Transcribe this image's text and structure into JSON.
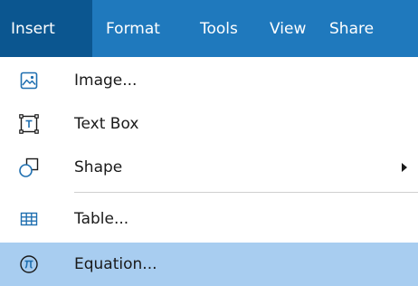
{
  "menubar": {
    "items": [
      {
        "label": "Insert",
        "active": true
      },
      {
        "label": "Format"
      },
      {
        "label": "Tools"
      },
      {
        "label": "View"
      },
      {
        "label": "Share"
      }
    ]
  },
  "menu": {
    "items": [
      {
        "label": "Image...",
        "icon": "image-icon"
      },
      {
        "label": "Text Box",
        "icon": "text-box-icon"
      },
      {
        "label": "Shape",
        "icon": "shape-icon",
        "submenu": true
      },
      {
        "label": "Table...",
        "icon": "table-icon"
      },
      {
        "label": "Equation...",
        "icon": "pi-icon",
        "highlighted": true
      }
    ]
  },
  "colors": {
    "menubar_bg": "#1f79bd",
    "menubar_active": "#0b5690",
    "highlight": "#a8cdf0",
    "icon": "#1f6fb0"
  }
}
